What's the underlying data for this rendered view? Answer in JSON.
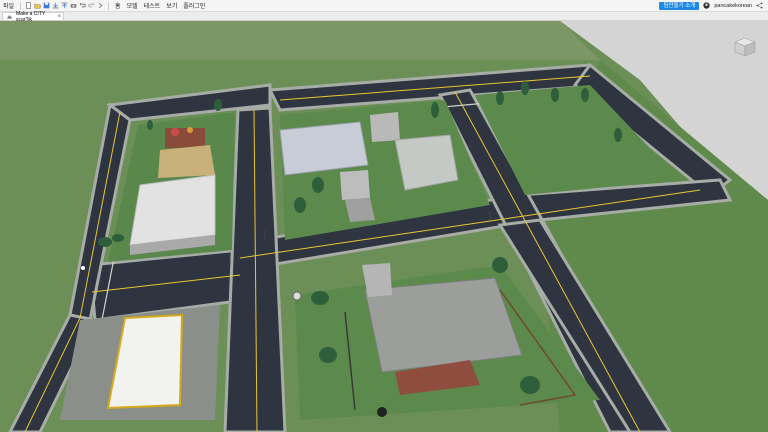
{
  "menu": {
    "file": "파일",
    "home": "홈",
    "model": "모델",
    "test": "테스트",
    "view": "보기",
    "plugins": "플러그인"
  },
  "toolbar_icons": [
    "new-file-icon",
    "open-file-icon",
    "save-icon",
    "import-icon",
    "publish-icon",
    "camera-icon",
    "undo-icon",
    "redo-icon",
    "expand-icon"
  ],
  "header": {
    "team_create_label": "팀만들기 소개",
    "username": "pancakekorean"
  },
  "tabs": [
    {
      "label": "Make a CITY scarTik",
      "active": true
    }
  ],
  "colors": {
    "accent": "#1e88e5",
    "grass": "#5e8a4f",
    "road": "#2e3540",
    "sidewalk": "#a7aca7"
  }
}
